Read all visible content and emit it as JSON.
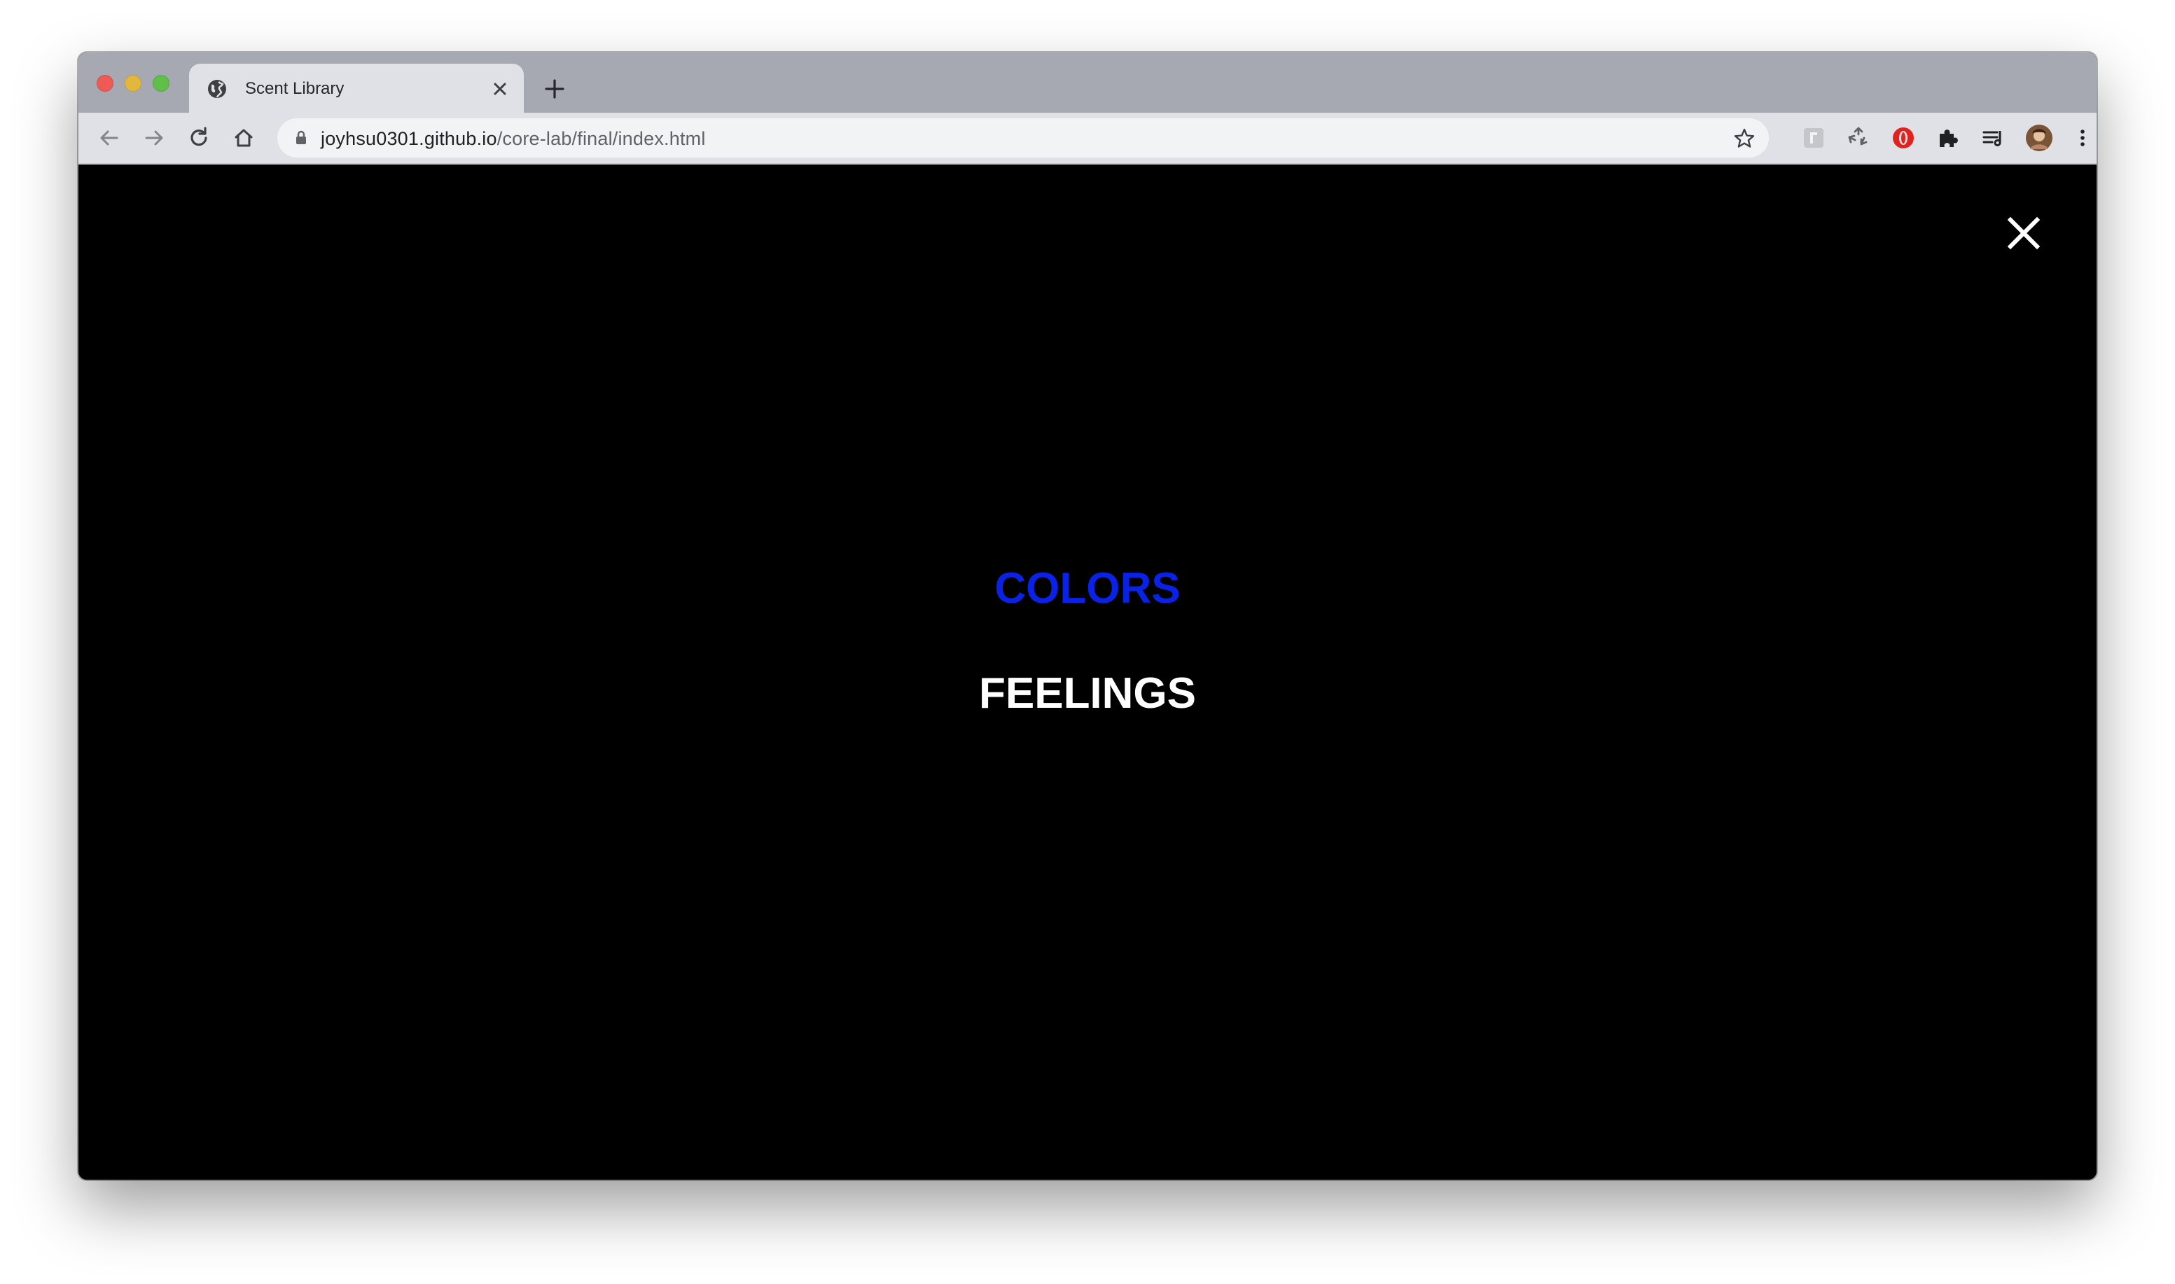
{
  "browser": {
    "tab": {
      "title": "Scent Library",
      "favicon": "globe-icon"
    },
    "toolbar": {
      "url_host": "joyhsu0301.github.io",
      "url_path": "/core-lab/final/index.html",
      "icons": [
        "back-arrow-icon",
        "forward-arrow-icon",
        "reload-icon",
        "home-icon",
        "lock-icon",
        "star-icon",
        "extension-gray-icon",
        "recycle-icon",
        "opera-icon",
        "puzzle-icon",
        "reading-list-icon",
        "avatar",
        "kebab-menu-icon"
      ]
    }
  },
  "page": {
    "background": "#000000",
    "close_icon": "close-icon",
    "menu": [
      {
        "label": "COLORS",
        "color": "#0a22e6"
      },
      {
        "label": "FEELINGS",
        "color": "#ffffff"
      }
    ]
  }
}
